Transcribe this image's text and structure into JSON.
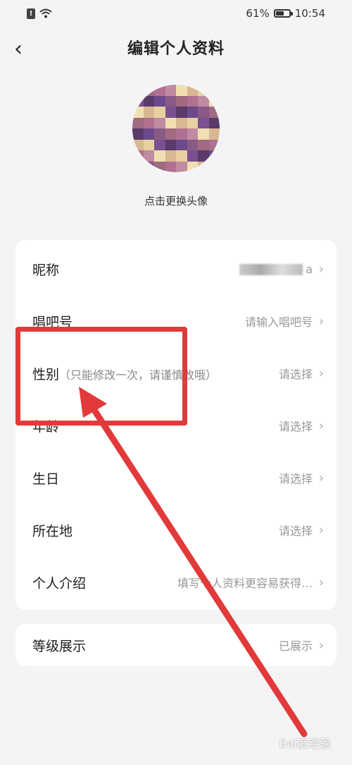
{
  "status_bar": {
    "battery": "61%",
    "battery_level": 0.61,
    "time": "10:54",
    "sim": "!"
  },
  "header": {
    "back": "‹",
    "title": "编辑个人资料"
  },
  "avatar": {
    "caption": "点击更换头像"
  },
  "profile_rows": [
    {
      "label": "昵称",
      "note": "",
      "value": "a"
    },
    {
      "label": "唱吧号",
      "note": "",
      "value": "请输入唱吧号"
    },
    {
      "label": "性别",
      "note": "（只能修改一次，请谨慎改哦）",
      "value": "请选择"
    },
    {
      "label": "年龄",
      "note": "",
      "value": "请选择"
    },
    {
      "label": "生日",
      "note": "",
      "value": "请选择"
    },
    {
      "label": "所在地",
      "note": "",
      "value": "请选择"
    },
    {
      "label": "个人介绍",
      "note": "",
      "value": "填写个人资料更容易获得…"
    }
  ],
  "level_row": {
    "label": "等级展示",
    "value": "已展示"
  },
  "chevron": "›",
  "watermark": "Bai度经验",
  "colors": {
    "annotation": "#e23a3a",
    "background": "#f4f4f6"
  }
}
